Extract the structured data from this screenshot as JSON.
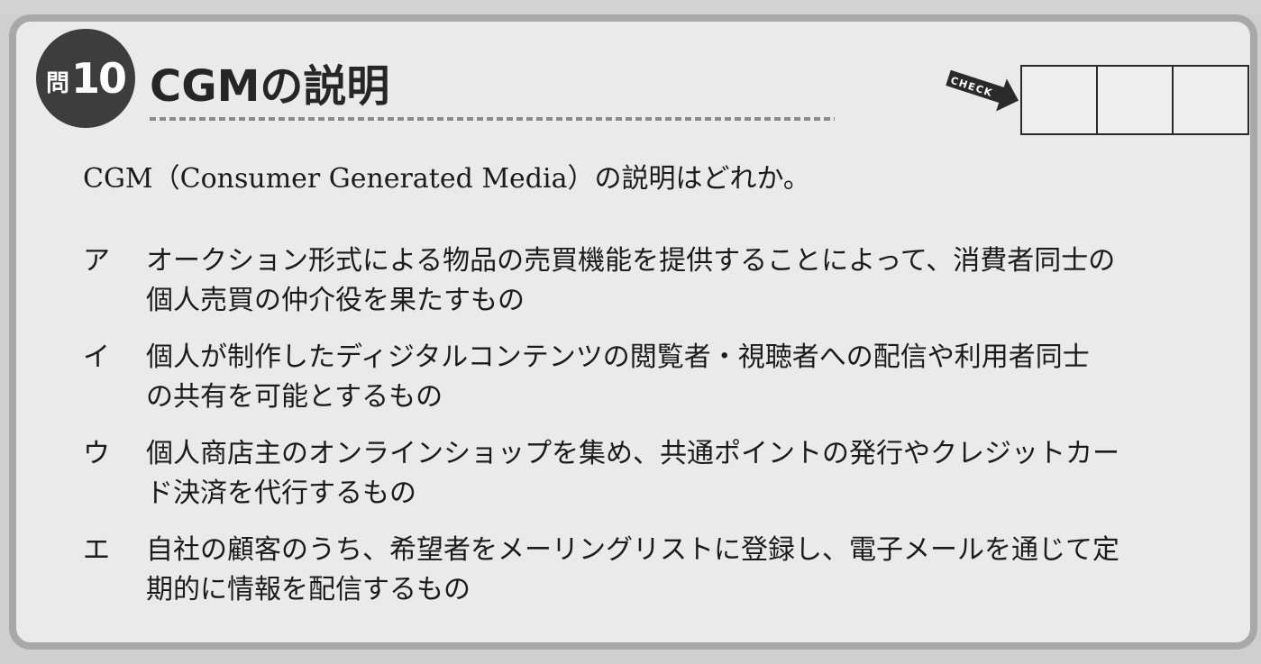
{
  "question": {
    "label": "問",
    "number": "10",
    "title": "CGMの説明",
    "check_label": "CHECK",
    "check_box_count": 3,
    "prompt": "CGM（Consumer Generated Media）の説明はどれか。"
  },
  "options": [
    {
      "letter": "ア",
      "lines": [
        "オークション形式による物品の売買機能を提供することによって、消費者同士の",
        "個人売買の仲介役を果たすもの"
      ]
    },
    {
      "letter": "イ",
      "lines": [
        "個人が制作したディジタルコンテンツの閲覧者・視聴者への配信や利用者同士",
        "の共有を可能とするもの"
      ]
    },
    {
      "letter": "ウ",
      "lines": [
        "個人商店主のオンラインショップを集め、共通ポイントの発行やクレジットカー",
        "ド決済を代行するもの"
      ]
    },
    {
      "letter": "エ",
      "lines": [
        "自社の顧客のうち、希望者をメーリングリストに登録し、電子メールを通じて定",
        "期的に情報を配信するもの"
      ]
    }
  ]
}
